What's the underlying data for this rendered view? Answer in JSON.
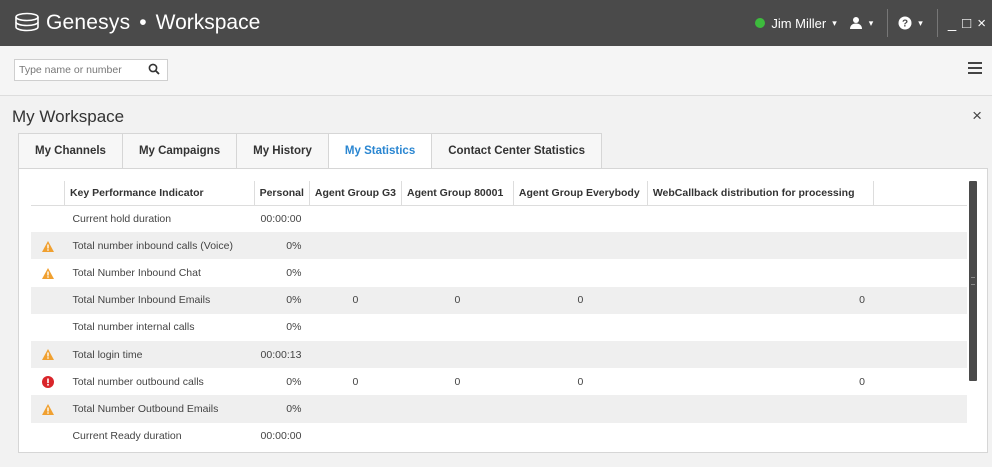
{
  "app": {
    "brand": "Genesys",
    "separator": "•",
    "product": "Workspace",
    "user_name": "Jim Miller",
    "caret": "▾",
    "icons": {
      "status": "status-dot-icon",
      "agent": "agent-icon",
      "help": "help-icon",
      "minimize": "minimize-icon",
      "maximize": "maximize-icon",
      "close": "close-icon",
      "search": "search-icon",
      "menu": "hamburger-menu-icon"
    },
    "window_controls": {
      "minimize": "_",
      "maximize": "□",
      "close": "×"
    },
    "status_color": "#3dbb3d"
  },
  "search": {
    "placeholder": "Type name or number"
  },
  "workspace": {
    "title": "My Workspace",
    "close": "×",
    "tabs": [
      {
        "label": "My Channels",
        "active": false
      },
      {
        "label": "My Campaigns",
        "active": false
      },
      {
        "label": "My History",
        "active": false
      },
      {
        "label": "My Statistics",
        "active": true
      },
      {
        "label": "Contact Center Statistics",
        "active": false
      }
    ]
  },
  "statistics": {
    "headers": [
      "",
      "Key Performance Indicator",
      "Personal",
      "Agent Group G3",
      "Agent Group 80001",
      "Agent Group Everybody",
      "WebCallback distribution for processing",
      ""
    ],
    "rows": [
      {
        "icon": "",
        "kpi": "Current hold duration",
        "personal": "00:00:00",
        "g3": "",
        "g80001": "",
        "everybody": "",
        "webcallback": ""
      },
      {
        "icon": "warning",
        "kpi": "Total number inbound calls (Voice)",
        "personal": "0%",
        "g3": "",
        "g80001": "",
        "everybody": "",
        "webcallback": ""
      },
      {
        "icon": "warning",
        "kpi": "Total Number Inbound Chat",
        "personal": "0%",
        "g3": "",
        "g80001": "",
        "everybody": "",
        "webcallback": ""
      },
      {
        "icon": "",
        "kpi": "Total Number Inbound Emails",
        "personal": "0%",
        "g3": "0",
        "g80001": "0",
        "everybody": "0",
        "webcallback": "0"
      },
      {
        "icon": "",
        "kpi": "Total number internal calls",
        "personal": "0%",
        "g3": "",
        "g80001": "",
        "everybody": "",
        "webcallback": ""
      },
      {
        "icon": "warning",
        "kpi": "Total login time",
        "personal": "00:00:13",
        "g3": "",
        "g80001": "",
        "everybody": "",
        "webcallback": ""
      },
      {
        "icon": "error",
        "kpi": "Total number outbound calls",
        "personal": "0%",
        "g3": "0",
        "g80001": "0",
        "everybody": "0",
        "webcallback": "0"
      },
      {
        "icon": "warning",
        "kpi": "Total Number Outbound Emails",
        "personal": "0%",
        "g3": "",
        "g80001": "",
        "everybody": "",
        "webcallback": ""
      },
      {
        "icon": "",
        "kpi": "Current Ready duration",
        "personal": "00:00:00",
        "g3": "",
        "g80001": "",
        "everybody": "",
        "webcallback": ""
      }
    ],
    "colors": {
      "warning": "#f0a030",
      "error": "#d9252a",
      "active_tab": "#2a86d1"
    }
  }
}
